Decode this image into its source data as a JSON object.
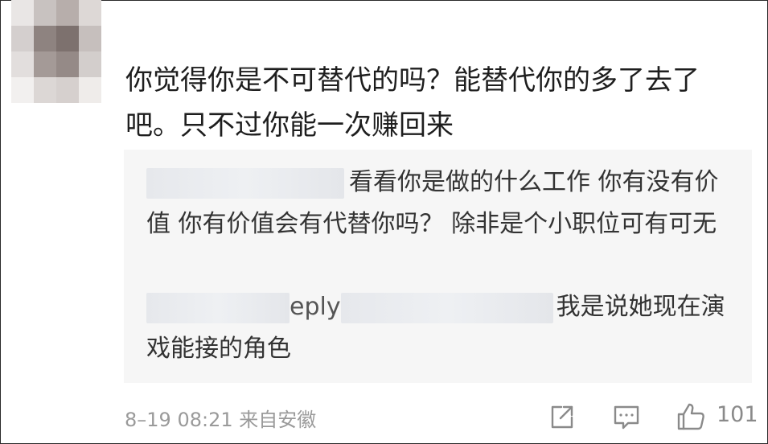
{
  "comment": {
    "text": "你觉得你是不可替代的吗？能替代你的多了去了吧。只不过你能一次赚回来"
  },
  "replies": [
    {
      "text": "看看你是做的什么工作 你有没有价值 你有价值会有代替你吗？ 除非是个小职位可有可无"
    },
    {
      "prefix": "eply",
      "text": "我是说她现在演戏能接的角色"
    }
  ],
  "footer": {
    "meta": "8–19 08:21 来自安徽",
    "like_count": "101"
  },
  "icons": {
    "share": "share-icon",
    "comment": "comment-icon",
    "like": "thumbs-up-icon"
  }
}
